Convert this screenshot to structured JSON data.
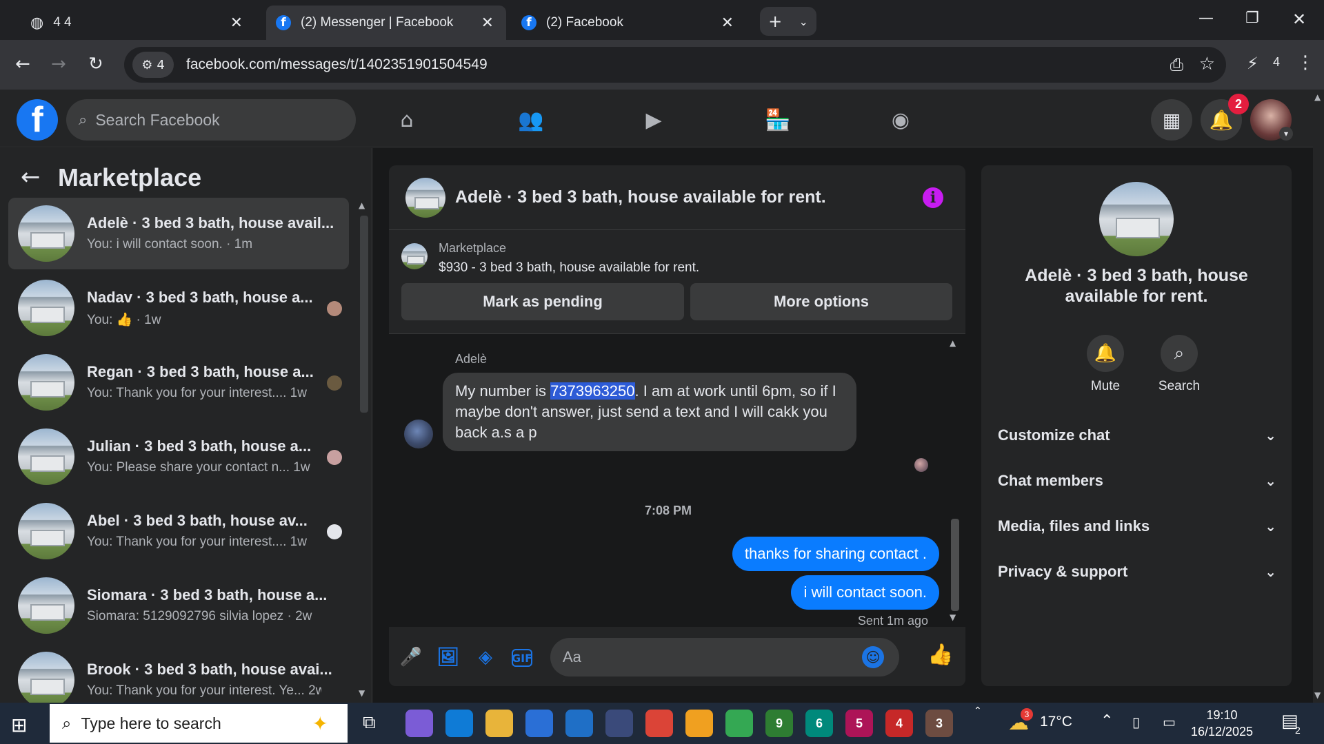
{
  "browser": {
    "tabs": [
      {
        "label": "4 4",
        "active": false
      },
      {
        "label": "(2) Messenger | Facebook",
        "active": true
      },
      {
        "label": "(2) Facebook",
        "active": false
      }
    ],
    "site_info_badge": "4",
    "url": "facebook.com/messages/t/1402351901504549",
    "extensions_count": "4"
  },
  "fb_header": {
    "search_placeholder": "Search Facebook",
    "notification_count": "2"
  },
  "sidebar": {
    "title": "Marketplace",
    "conversations": [
      {
        "name": "Adelè · 3 bed 3 bath, house avail...",
        "preview": "You: i will contact soon. · 1m",
        "selected": true
      },
      {
        "name": "Nadav · 3 bed 3 bath, house a...",
        "preview": "You: 👍 · 1w",
        "selected": false
      },
      {
        "name": "Regan · 3 bed 3 bath, house a...",
        "preview": "You: Thank you for your interest....  1w",
        "selected": false
      },
      {
        "name": "Julian · 3 bed 3 bath, house a...",
        "preview": "You: Please share your contact n...  1w",
        "selected": false
      },
      {
        "name": "Abel · 3 bed 3 bath, house av...",
        "preview": "You: Thank you for your interest....  1w",
        "selected": false
      },
      {
        "name": "Siomara · 3 bed 3 bath, house a...",
        "preview": "Siomara: 5129092796 silvia lopez · 2w",
        "selected": false
      },
      {
        "name": "Brook · 3 bed 3 bath, house avai...",
        "preview": "You: Thank you for your interest. Ye...  2w",
        "selected": false
      }
    ]
  },
  "chat": {
    "title": "Adelè · 3 bed 3 bath, house available for rent.",
    "listing_label": "Marketplace",
    "listing_price": "$930 - 3 bed 3 bath, house available for rent.",
    "mark_pending_label": "Mark as pending",
    "more_options_label": "More options",
    "sender_name": "Adelè",
    "incoming_pre": "My number is ",
    "incoming_highlight": "7373963250",
    "incoming_post": ". I am at work until 6pm, so if I maybe don't answer, just send a text and I will cakk you back a.s a p",
    "timestamp": "7:08 PM",
    "outgoing": [
      "thanks for sharing contact .",
      "i will contact soon."
    ],
    "sent_status": "Sent 1m ago",
    "composer_placeholder": "Aa"
  },
  "details": {
    "name": "Adelè · 3 bed 3 bath, house available for rent.",
    "mute_label": "Mute",
    "search_label": "Search",
    "sections": [
      "Customize chat",
      "Chat members",
      "Media, files and links",
      "Privacy & support"
    ]
  },
  "taskbar": {
    "search_placeholder": "Type here to search",
    "apps": [
      {
        "label": "",
        "color": "#7b5cd6"
      },
      {
        "label": "",
        "color": "#0f7bd6"
      },
      {
        "label": "",
        "color": "#e8b43a"
      },
      {
        "label": "",
        "color": "#2a6fd6"
      },
      {
        "label": "",
        "color": "#1f6fc6"
      },
      {
        "label": "",
        "color": "#3a4a7a"
      },
      {
        "label": "",
        "color": "#db4437"
      },
      {
        "label": "",
        "color": "#f0a020"
      },
      {
        "label": "",
        "color": "#34a853"
      },
      {
        "label": "9",
        "color": "#2e7d32"
      },
      {
        "label": "6",
        "color": "#00897b"
      },
      {
        "label": "5",
        "color": "#ad1457"
      },
      {
        "label": "4",
        "color": "#c62828"
      },
      {
        "label": "3",
        "color": "#6d4c41"
      }
    ],
    "temperature": "17°C",
    "weather_badge": "3",
    "time": "19:10",
    "date": "16/12/2025",
    "notifications": "2"
  }
}
